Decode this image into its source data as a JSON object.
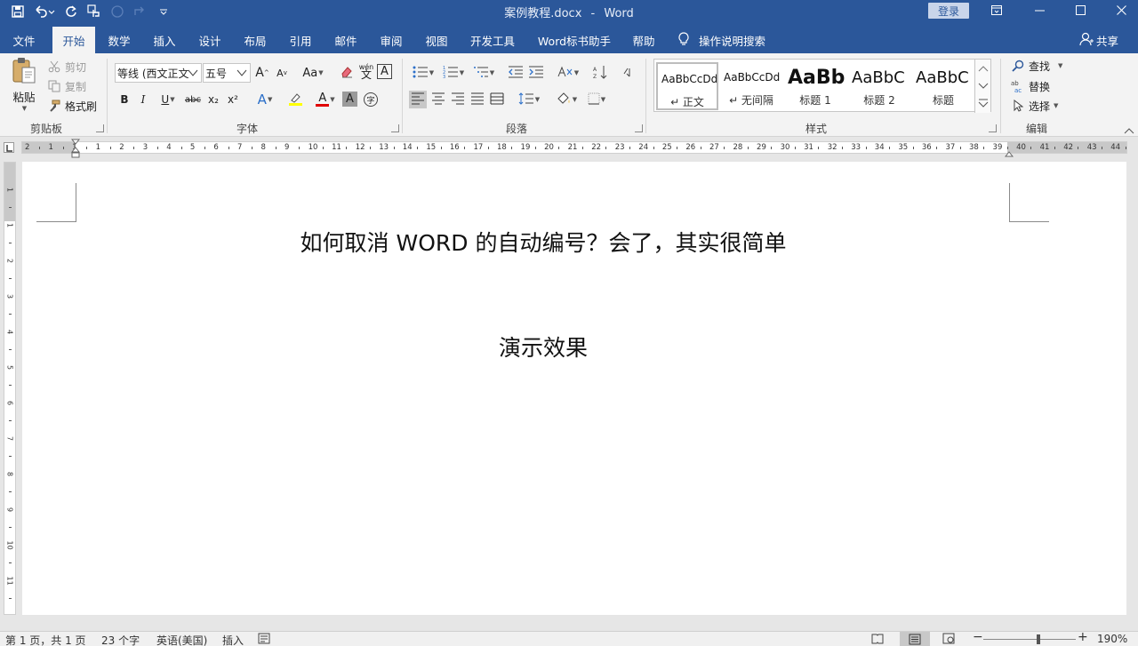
{
  "app": {
    "doc_title": "案例教程.docx",
    "separator": "-",
    "app_name": "Word",
    "login_label": "登录"
  },
  "tabs": [
    {
      "label": "文件"
    },
    {
      "label": "开始"
    },
    {
      "label": "数学"
    },
    {
      "label": "插入"
    },
    {
      "label": "设计"
    },
    {
      "label": "布局"
    },
    {
      "label": "引用"
    },
    {
      "label": "邮件"
    },
    {
      "label": "审阅"
    },
    {
      "label": "视图"
    },
    {
      "label": "开发工具"
    },
    {
      "label": "Word标书助手"
    },
    {
      "label": "帮助"
    }
  ],
  "tell_me": "操作说明搜索",
  "share_label": "共享",
  "ribbon": {
    "clipboard": {
      "paste": "粘贴",
      "cut": "剪切",
      "copy": "复制",
      "format_painter": "格式刷",
      "group": "剪贴板"
    },
    "font": {
      "font_name": "等线 (西文正文)",
      "font_size": "五号",
      "group": "字体",
      "bold": "B",
      "italic": "I",
      "underline": "U",
      "strike": "abc",
      "subscript": "x₂",
      "superscript": "x²",
      "change_case": "Aa",
      "grow": "A",
      "shrink": "A",
      "phonetic": "wén",
      "border_char": "A",
      "text_effect": "A",
      "font_color": "A",
      "shade_char": "A",
      "enclose": "字",
      "accent_highlight": "#ffff00",
      "accent_font": "#e00000"
    },
    "paragraph": {
      "group": "段落"
    },
    "styles": {
      "group": "样式",
      "items": [
        {
          "sample": "AaBbCcDd",
          "name": "↵ 正文"
        },
        {
          "sample": "AaBbCcDd",
          "name": "↵ 无间隔"
        },
        {
          "sample": "AaBb",
          "name": "标题 1"
        },
        {
          "sample": "AaBbC",
          "name": "标题 2"
        },
        {
          "sample": "AaBbC",
          "name": "标题"
        }
      ]
    },
    "editing": {
      "find": "查找",
      "replace": "替换",
      "select": "选择",
      "group": "编辑"
    }
  },
  "ruler": {
    "h_ticks": [
      "2",
      "1",
      "1",
      "1",
      "2",
      "3",
      "4",
      "5",
      "6",
      "7",
      "8",
      "9",
      "10",
      "11",
      "12",
      "13",
      "14",
      "15",
      "16",
      "17",
      "18",
      "19",
      "20",
      "21",
      "22",
      "23",
      "24",
      "25",
      "26",
      "27",
      "28",
      "29",
      "30",
      "31",
      "32",
      "33",
      "34",
      "35",
      "36",
      "37",
      "38",
      "39",
      "40",
      "41",
      "42",
      "43",
      "44"
    ],
    "v_ticks": [
      "1",
      "1",
      "2",
      "3",
      "4",
      "5",
      "6",
      "7",
      "8",
      "9",
      "10",
      "11"
    ]
  },
  "document": {
    "heading": "如何取消 WORD 的自动编号？会了，其实很简单",
    "subheading": "演示效果"
  },
  "status": {
    "page": "第 1 页，共 1 页",
    "words": "23 个字",
    "language": "英语(美国)",
    "mode": "插入",
    "zoom": "190%"
  },
  "colors": {
    "brand": "#2b579a"
  }
}
